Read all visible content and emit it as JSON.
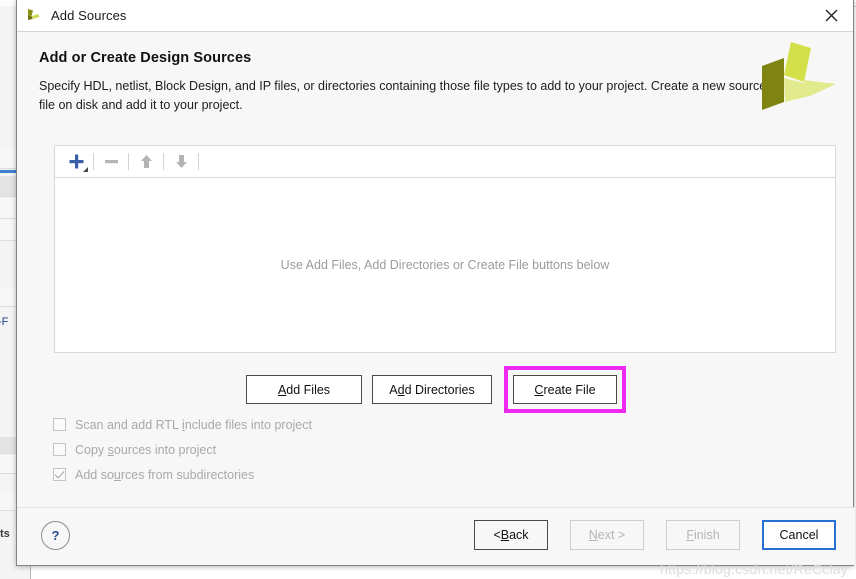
{
  "window": {
    "title": "Add Sources",
    "icon": "vivado-logo-icon",
    "close_label": "✕"
  },
  "header": {
    "heading": "Add or Create Design Sources",
    "description": "Specify HDL, netlist, Block Design, and IP files, or directories containing those file types to add to your project. Create a new source file on disk and add it to your project.",
    "logo": "xilinx-logo-icon"
  },
  "toolbar": {
    "add_label": "+",
    "remove_label": "−",
    "move_up_label": "▲",
    "move_down_label": "▼"
  },
  "source_list": {
    "empty_message": "Use Add Files, Add Directories or Create File buttons below"
  },
  "actions": {
    "add_files": {
      "pre": "",
      "accel": "A",
      "post": "dd Files"
    },
    "add_directories": {
      "pre": "A",
      "accel": "d",
      "post": "d Directories"
    },
    "create_file": {
      "pre": "",
      "accel": "C",
      "post": "reate File"
    },
    "create_file_highlighted": true
  },
  "options": [
    {
      "pre": "Scan and add RTL ",
      "accel": "i",
      "post": "nclude files into project",
      "checked": false,
      "enabled": false
    },
    {
      "pre": "Copy ",
      "accel": "s",
      "post": "ources into project",
      "checked": false,
      "enabled": false
    },
    {
      "pre": "Add so",
      "accel": "u",
      "post": "rces from subdirectories",
      "checked": true,
      "enabled": false
    }
  ],
  "footer": {
    "help_label": "?",
    "back": {
      "pre": "< ",
      "accel": "B",
      "post": "ack",
      "state": "enabled"
    },
    "next": {
      "pre": "",
      "accel": "N",
      "post": "ext >",
      "state": "disabled"
    },
    "finish": {
      "pre": "",
      "accel": "F",
      "post": "inish",
      "state": "disabled"
    },
    "cancel": {
      "pre": "Cancel",
      "accel": "",
      "post": "",
      "state": "focused"
    }
  },
  "watermark": "https://blog.csdn.net/ReCclay",
  "background": {
    "side_label_top": "-F",
    "side_label_bottom": "ts"
  },
  "colors": {
    "accent_magenta": "#ef29ef",
    "focus_blue": "#2a6fd4",
    "help_blue": "#2a4b91",
    "logo_dark": "#7f8410",
    "logo_mid": "#d4e04a",
    "logo_light": "#e2ea8e",
    "plus_blue": "#3a5fa8",
    "disabled_text": "#b5b5b5"
  }
}
